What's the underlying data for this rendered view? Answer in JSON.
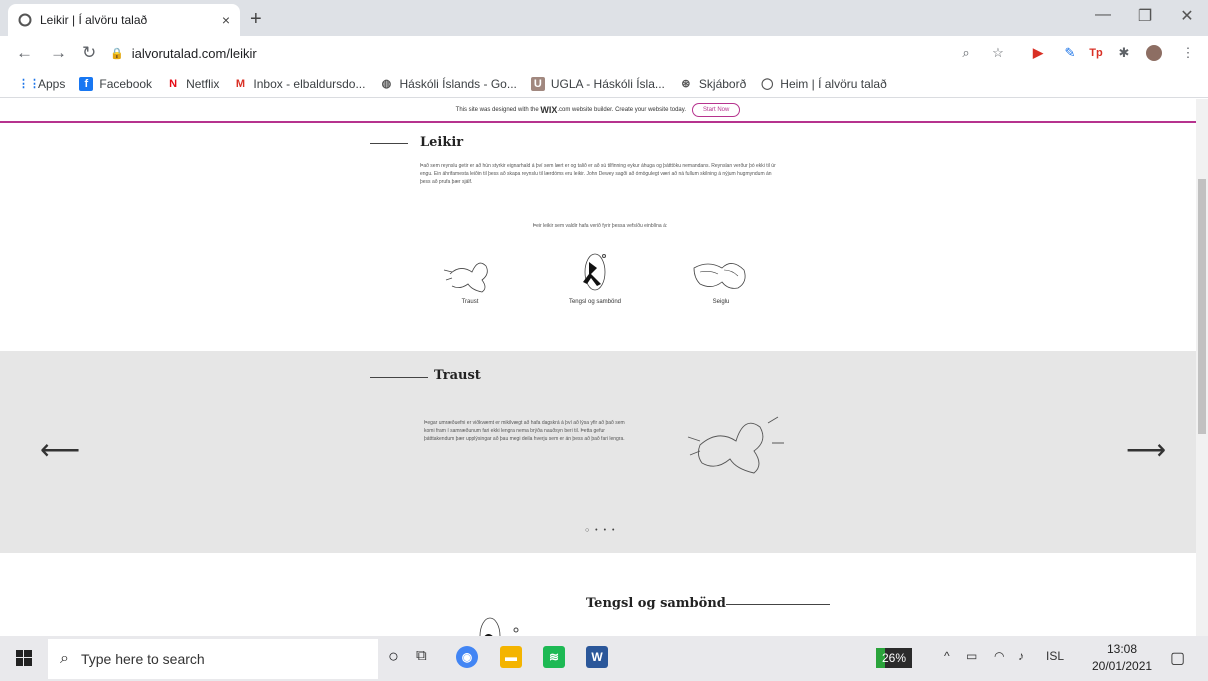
{
  "browser": {
    "tab_title": "Leikir | Í alvöru talað",
    "tab_close": "×",
    "new_tab": "+",
    "url": "ialvorutalad.com/leikir",
    "window_controls": [
      "—",
      "❐",
      "✕"
    ]
  },
  "bookmarks": [
    {
      "label": "Apps",
      "icon": "apps-grid-icon"
    },
    {
      "label": "Facebook",
      "icon": "facebook-icon"
    },
    {
      "label": "Netflix",
      "icon": "netflix-icon"
    },
    {
      "label": "Inbox - elbaldursdo...",
      "icon": "gmail-icon"
    },
    {
      "label": "Háskóli Íslands - Go...",
      "icon": "globe-icon"
    },
    {
      "label": "UGLA - Háskóli Ísla...",
      "icon": "ugla-icon"
    },
    {
      "label": "Skjáborð",
      "icon": "skjabord-icon"
    },
    {
      "label": "Heim | Í alvöru talað",
      "icon": "wix-site-icon"
    }
  ],
  "wix_banner": {
    "text_before": "This site was designed with the",
    "brand": "WIX",
    "text_after": ".com website builder. Create your website today.",
    "button": "Start Now"
  },
  "page": {
    "leikir": {
      "heading": "Leikir",
      "intro": "Það sem reynslu getir er að hún styrkir eignarhald á því sem lært er og talið er að sú tilfinning eykur áhuga og þátttöku nemandans. Reynslan verður þó ekki til úr engu. Ein áhrifamesta leiðin til þess að skapa reynslu til lærdóms eru leikir. John Dewey sagði að ómögulegt væri að ná fullum skilning á nýjum hugmyndum án þess að prufa þær sjálf.",
      "games_intro": "Þeir leikir sem valdir hafa verið fyrir þessa vefsíðu einblína á:",
      "games": [
        "Traust",
        "Tengsl og sambönd",
        "Seiglu"
      ]
    },
    "traust": {
      "heading": "Traust",
      "text": "Þegar umræðuefni er viðkvæmt er mikilvægt að hafa dagskrá á því að lýsa yfir að það sem komi fram í samræðunum fari ekki lengra nema brýða nauðsyn beri til. Þetta gefur þátttakendum þær upplýsingar að þau megi deila hverju sem er án þess að það fari lengra.",
      "prev_arrow": "⟵",
      "next_arrow": "⟶",
      "dots": "○ • • •"
    },
    "tengsl": {
      "heading": "Tengsl og sambönd"
    }
  },
  "taskbar": {
    "search_placeholder": "Type here to search",
    "battery": "26%",
    "battery_level": 0.26,
    "language": "ISL",
    "time": "13:08",
    "date": "20/01/2021"
  }
}
